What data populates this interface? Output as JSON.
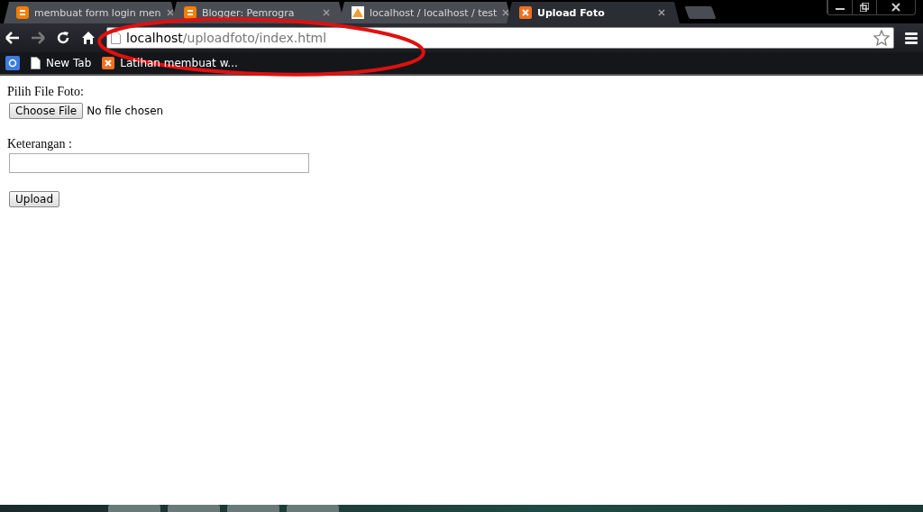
{
  "browser": {
    "tabs": [
      {
        "title": "membuat form login men",
        "kind": "blogger",
        "selected": false
      },
      {
        "title": "Blogger: Pemrogra",
        "kind": "blogger",
        "selected": false
      },
      {
        "title": "localhost / localhost / test",
        "kind": "pma",
        "selected": false
      },
      {
        "title": "Upload Foto",
        "kind": "xampp",
        "selected": true
      }
    ],
    "address": {
      "host": "localhost",
      "path": "/uploadfoto/index.html"
    },
    "bookmarks": [
      {
        "label": "New Tab",
        "kind": "page"
      },
      {
        "label": "Latihan membuat w...",
        "kind": "xampp"
      }
    ]
  },
  "form": {
    "file_label": "Pilih File Foto:",
    "file_button": "Choose File",
    "file_status": "No file chosen",
    "note_label": "Keterangan :",
    "submit": "Upload"
  }
}
